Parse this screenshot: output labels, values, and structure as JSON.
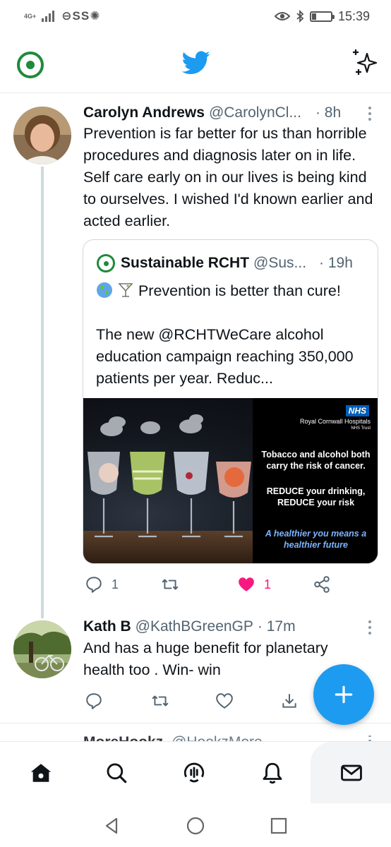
{
  "status_bar": {
    "network": "4G+",
    "left_glyphs": "⊖SS✺",
    "time": "15:39",
    "battery_level": 0.2,
    "icons": [
      "signal-icon",
      "spotify-icon",
      "s-app-icon",
      "brightness-icon",
      "eye-icon",
      "bluetooth-icon",
      "battery-icon"
    ]
  },
  "top_bar": {
    "icons": [
      "profile-avatar",
      "twitter-bird-icon",
      "sparkle-icon"
    ],
    "accent_color": "#1d9bf0"
  },
  "tweets": [
    {
      "name": "Carolyn Andrews",
      "handle": "@CarolynCl...",
      "time": "· 8h",
      "text": "Prevention is far better for us than horrible procedures and diagnosis later on in life. Self care early on in our lives is being kind to ourselves. I wished I'd known earlier and acted earlier.",
      "quote": {
        "name": "Sustainable RCHT",
        "handle": "@Sus...",
        "time": "· 19h",
        "line1": "Prevention is better than cure!",
        "line2": "The new @RCHTWeCare alcohol education campaign reaching 350,000 patients per year. Reduc...",
        "image": {
          "nhs_logo": "NHS",
          "org": "Royal Cornwall Hospitals",
          "trust": "NHS Trust",
          "message": "Tobacco and alcohol both carry the risk of cancer.",
          "message2": "REDUCE your drinking, REDUCE your risk",
          "tagline": "A healthier you means a healthier future"
        }
      },
      "reply_count": "1",
      "like_count": "1",
      "liked": true
    },
    {
      "name": "Kath B",
      "handle": "@KathBGreenGP",
      "time": "· 17m",
      "text": "And has a huge benefit for planetary health too . Win- win"
    }
  ],
  "peek_tweet": {
    "name": "MoreHookz",
    "handle": "@HookzMore"
  },
  "bottom_nav": [
    "home-icon",
    "search-icon",
    "spaces-icon",
    "notifications-icon",
    "messages-icon"
  ],
  "colors": {
    "like": "#f91880",
    "nhs_blue": "#005eb8",
    "badge_green": "#1f8a3a"
  }
}
